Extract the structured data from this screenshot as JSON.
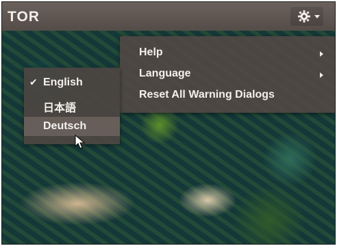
{
  "header": {
    "title": "TOR",
    "settings_icon": "gear-icon",
    "dropdown_icon": "chevron-down-icon"
  },
  "menu": {
    "items": [
      {
        "label": "Help",
        "has_submenu": true
      },
      {
        "label": "Language",
        "has_submenu": true
      },
      {
        "label": "Reset All Warning Dialogs",
        "has_submenu": false
      }
    ]
  },
  "language_menu": {
    "items": [
      {
        "label": "English",
        "checked": true
      },
      {
        "label": "日本語",
        "checked": false
      },
      {
        "label": "Deutsch",
        "checked": false
      }
    ],
    "check_symbol": "✔",
    "hovered_label": "Deutsch"
  },
  "colors": {
    "menu_bg": "#504844",
    "text": "#f4f1ee"
  }
}
